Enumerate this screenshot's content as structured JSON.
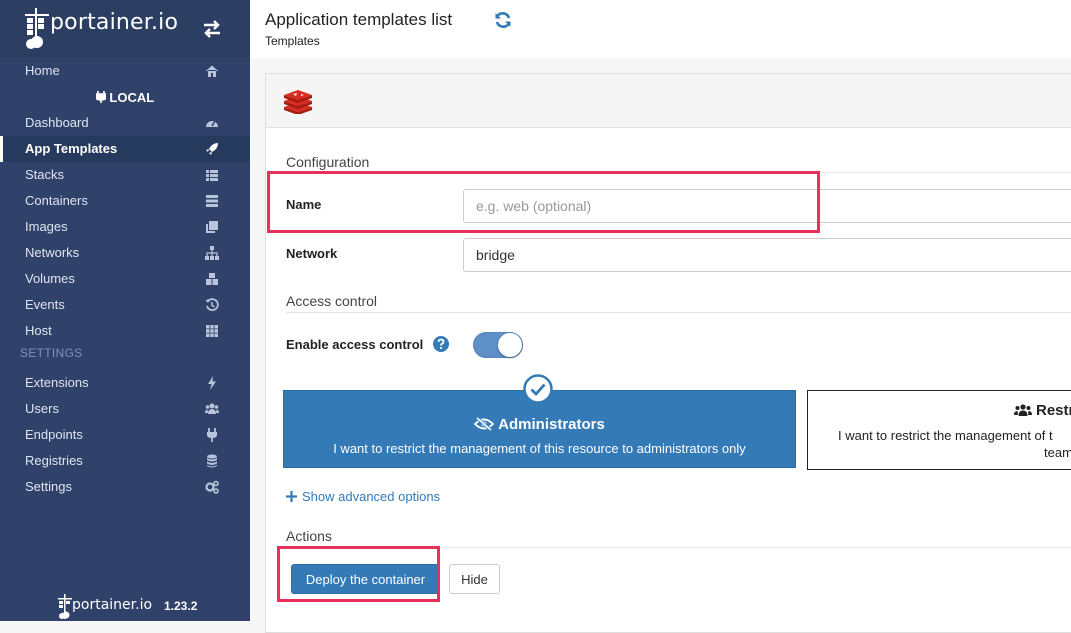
{
  "sidebar": {
    "brand": "portainer.io",
    "items": [
      {
        "label": "Home",
        "icon": "home-icon"
      },
      {
        "label": "Dashboard",
        "icon": "tachometer-icon"
      },
      {
        "label": "App Templates",
        "icon": "rocket-icon"
      },
      {
        "label": "Stacks",
        "icon": "th-list-icon"
      },
      {
        "label": "Containers",
        "icon": "server-icon"
      },
      {
        "label": "Images",
        "icon": "clone-icon"
      },
      {
        "label": "Networks",
        "icon": "sitemap-icon"
      },
      {
        "label": "Volumes",
        "icon": "cubes-icon"
      },
      {
        "label": "Events",
        "icon": "history-icon"
      },
      {
        "label": "Host",
        "icon": "th-icon"
      },
      {
        "label": "Extensions",
        "icon": "bolt-icon"
      },
      {
        "label": "Users",
        "icon": "users-icon"
      },
      {
        "label": "Endpoints",
        "icon": "plug-icon"
      },
      {
        "label": "Registries",
        "icon": "database-icon"
      },
      {
        "label": "Settings",
        "icon": "cogs-icon"
      }
    ],
    "active_item": "App Templates",
    "endpoint_label": "LOCAL",
    "settings_section": "SETTINGS",
    "footer_brand": "portainer.io",
    "footer_version": "1.23.2"
  },
  "header": {
    "title": "Application templates list",
    "breadcrumb": "Templates"
  },
  "form": {
    "configuration_title": "Configuration",
    "name_label": "Name",
    "name_placeholder": "e.g. web (optional)",
    "name_value": "",
    "network_label": "Network",
    "network_value": "bridge",
    "access_control_title": "Access control",
    "enable_access_label": "Enable access control",
    "enable_access_on": true,
    "admin_option_title": "Administrators",
    "admin_option_desc": "I want to restrict the management of this resource to administrators only",
    "restricted_option_title": "Restri",
    "restricted_option_desc_1": "I want to restrict the management of t",
    "restricted_option_desc_2": "team",
    "advanced_link": "Show advanced options",
    "actions_title": "Actions",
    "deploy_button": "Deploy the container",
    "hide_button": "Hide"
  },
  "colors": {
    "sidebar_bg": "#30426a",
    "primary": "#337ab7",
    "highlight": "#e8305a",
    "redis_red": "#d82c20"
  }
}
